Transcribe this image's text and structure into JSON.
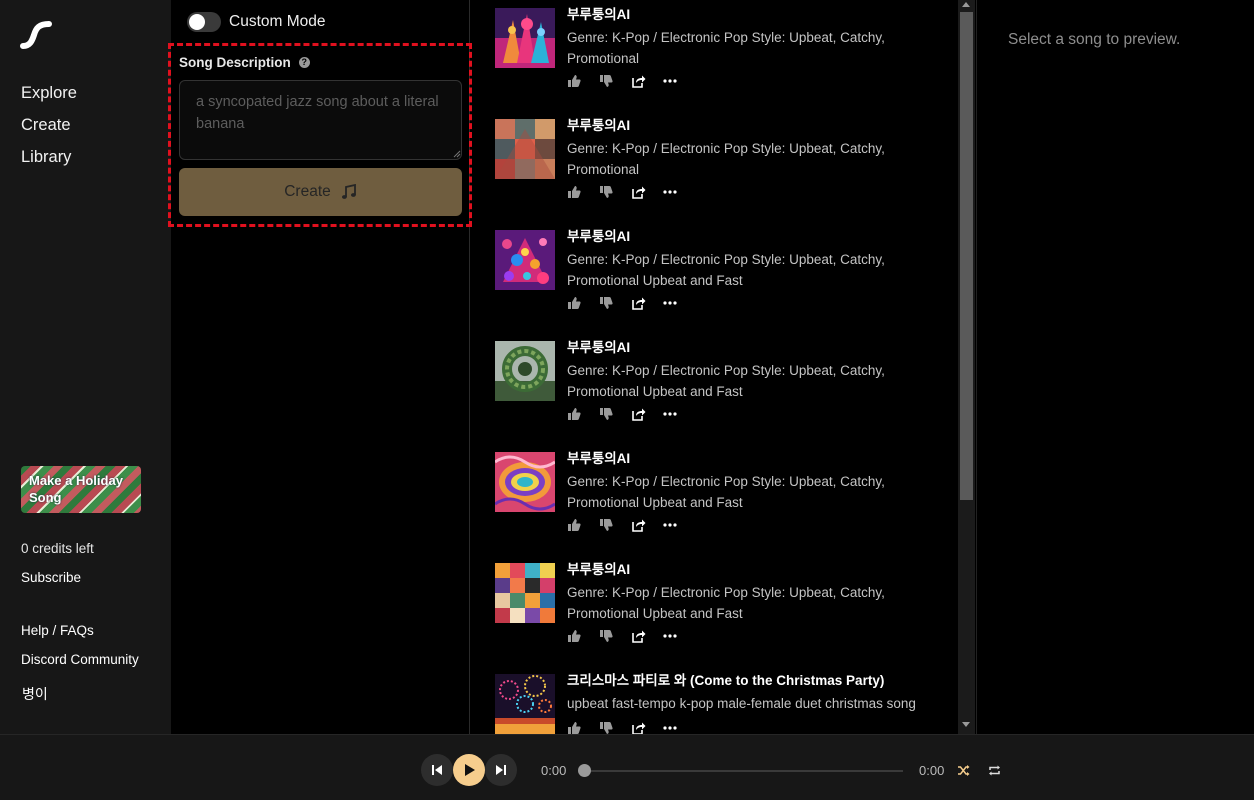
{
  "sidebar": {
    "nav": [
      {
        "label": "Explore"
      },
      {
        "label": "Create"
      },
      {
        "label": "Library"
      }
    ],
    "promo": "Make a Holiday Song",
    "credits": "0 credits left",
    "subscribe": "Subscribe",
    "help": "Help / FAQs",
    "discord": "Discord Community",
    "user": "병이"
  },
  "create": {
    "custom_mode_label": "Custom Mode",
    "custom_mode_on": false,
    "description_label": "Song Description",
    "description_placeholder": "a syncopated jazz song about a literal banana",
    "create_label": "Create"
  },
  "songs": [
    {
      "title": "부루퉁의AI",
      "desc": "Genre: K-Pop / Electronic Pop Style: Upbeat, Catchy, Promotional",
      "art": "neon-figures"
    },
    {
      "title": "부루퉁의AI",
      "desc": "Genre: K-Pop / Electronic Pop Style: Upbeat, Catchy, Promotional",
      "art": "mosaic-shapes"
    },
    {
      "title": "부루퉁의AI",
      "desc": "Genre: K-Pop / Electronic Pop Style: Upbeat, Catchy, Promotional Upbeat and Fast",
      "art": "bubble-balls"
    },
    {
      "title": "부루퉁의AI",
      "desc": "Genre: K-Pop / Electronic Pop Style: Upbeat, Catchy, Promotional Upbeat and Fast",
      "art": "green-ring"
    },
    {
      "title": "부루퉁의AI",
      "desc": "Genre: K-Pop / Electronic Pop Style: Upbeat, Catchy, Promotional Upbeat and Fast",
      "art": "psychedelic-swirl"
    },
    {
      "title": "부루퉁의AI",
      "desc": "Genre: K-Pop / Electronic Pop Style: Upbeat, Catchy, Promotional Upbeat and Fast",
      "art": "geometric-patches"
    },
    {
      "title": "크리스마스 파티로 와 (Come to the Christmas Party)",
      "desc": "upbeat fast-tempo k-pop male-female duet christmas song",
      "art": "fireworks"
    }
  ],
  "preview": {
    "text": "Select a song to preview."
  },
  "player": {
    "current_time": "0:00",
    "total_time": "0:00",
    "progress": 0
  },
  "colors": {
    "accent": "#f6cd8d",
    "create_button": "#6f5d3f",
    "highlight_border": "#e0101e"
  }
}
